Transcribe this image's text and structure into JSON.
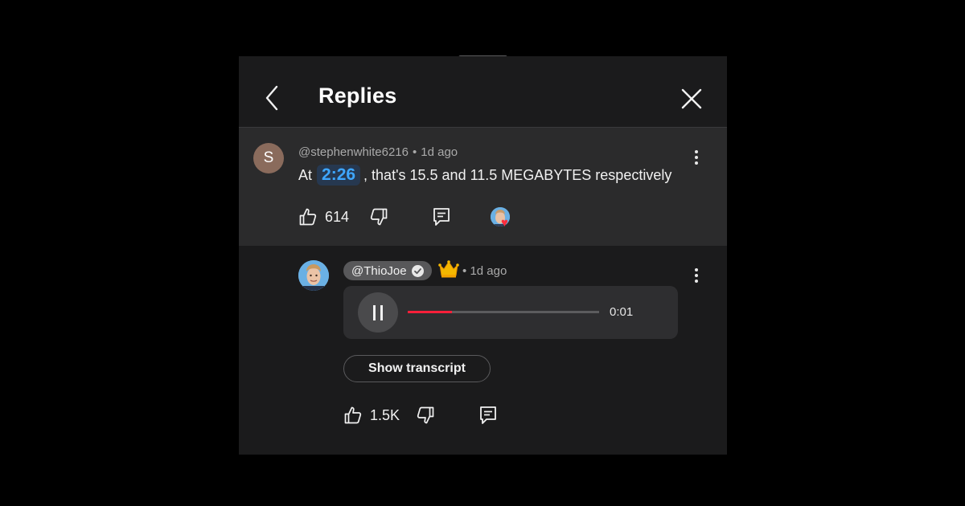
{
  "header": {
    "title": "Replies",
    "back_icon": "chevron-left-icon",
    "close_icon": "close-icon"
  },
  "parent_comment": {
    "avatar_letter": "S",
    "avatar_color": "#8a6b5c",
    "author": "@stephenwhite6216",
    "separator": "•",
    "time_ago": "1d ago",
    "text_prefix": "At",
    "timestamp_link": "2:26",
    "text_suffix": ", that's 15.5 and 11.5 MEGABYTES respectively",
    "likes": "614",
    "creator_heart": true
  },
  "reply": {
    "author": "@ThioJoe",
    "verified": true,
    "badge": "crown-icon",
    "separator": "•",
    "time_ago": "1d ago",
    "audio": {
      "state": "playing",
      "progress": 0.23,
      "time": "0:01"
    },
    "transcript_button": "Show transcript",
    "likes": "1.5K"
  },
  "colors": {
    "background": "#000000",
    "panel": "#1b1b1c",
    "highlighted_comment": "#2b2b2c",
    "link_blue": "#3ea6ff",
    "progress_red": "#ff1f3a",
    "heart_red": "#ff2d3b"
  }
}
